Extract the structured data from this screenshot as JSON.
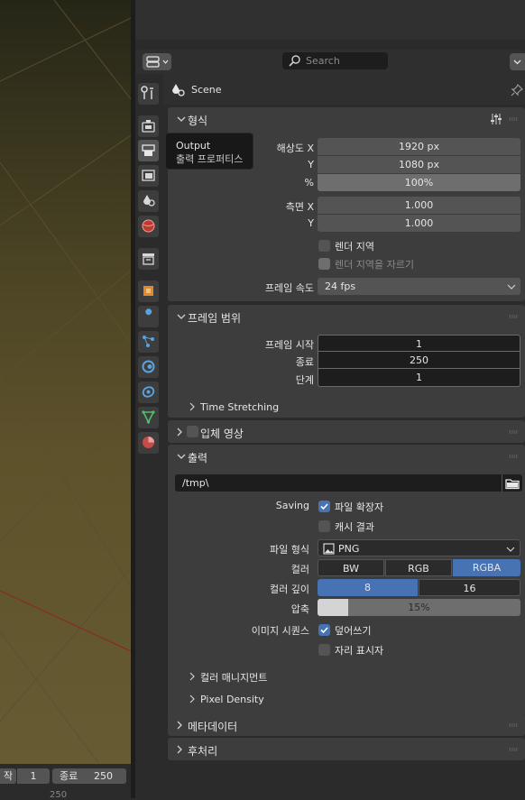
{
  "timeline": {
    "start_label": "작",
    "start_value": "1",
    "end_label": "종료",
    "end_value": "250",
    "bottom_text": "250"
  },
  "header": {
    "search_placeholder": "Search"
  },
  "context": {
    "scene_label": "Scene"
  },
  "tooltip": {
    "title": "Output",
    "description": "출력 프로퍼티스"
  },
  "format_panel": {
    "title": "형식",
    "resolution_x_label": "해상도 X",
    "resolution_x": "1920 px",
    "resolution_y_label": "Y",
    "resolution_y": "1080 px",
    "percent_label": "%",
    "percent": "100%",
    "aspect_x_label": "측면 X",
    "aspect_x": "1.000",
    "aspect_y_label": "Y",
    "aspect_y": "1.000",
    "render_region_label": "렌더 지역",
    "render_region_checked": false,
    "crop_region_label": "렌더 지역을 자르기",
    "crop_region_checked": false,
    "frame_rate_label": "프레임 속도",
    "frame_rate": "24 fps"
  },
  "frame_range_panel": {
    "title": "프레임 범위",
    "start_label": "프레임 시작",
    "start": "1",
    "end_label": "종료",
    "end": "250",
    "step_label": "단계",
    "step": "1",
    "time_stretching_label": "Time Stretching"
  },
  "stereoscopy_panel": {
    "title": "입체 영상",
    "enabled": false
  },
  "output_panel": {
    "title": "출력",
    "path": "/tmp\\",
    "saving_label": "Saving",
    "file_ext_label": "파일 확장자",
    "file_ext_checked": true,
    "cache_result_label": "캐시 결과",
    "cache_result_checked": false,
    "file_format_label": "파일 형식",
    "file_format": "PNG",
    "color_label": "컬러",
    "color_options": [
      "BW",
      "RGB",
      "RGBA"
    ],
    "color_selected": "RGBA",
    "color_depth_label": "컬러 깊이",
    "color_depth_options": [
      "8",
      "16"
    ],
    "color_depth_selected": "8",
    "compression_label": "압축",
    "compression": "15%",
    "compression_fraction": 0.15,
    "image_sequence_label": "이미지 시퀀스",
    "overwrite_label": "덮어쓰기",
    "overwrite_checked": true,
    "placeholders_label": "자리 표시자",
    "placeholders_checked": false,
    "color_management_label": "컬러 매니지먼트",
    "pixel_density_label": "Pixel Density"
  },
  "metadata_panel": {
    "title": "메타데이터"
  },
  "post_processing_panel": {
    "title": "후처리"
  },
  "colors": {
    "accent": "#4772b3",
    "panel": "#3d3d3d",
    "field": "#545454",
    "background": "#2b2b2b"
  }
}
